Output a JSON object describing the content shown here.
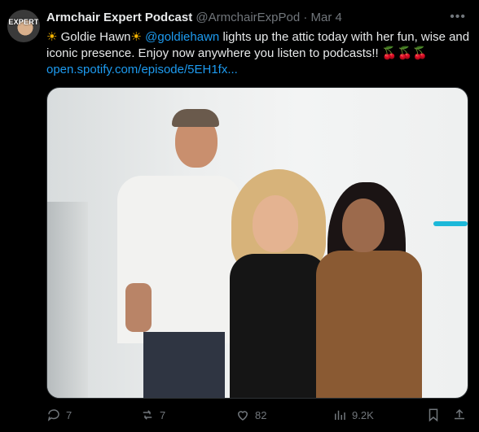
{
  "author": {
    "avatar_text": "EXPERT",
    "name": "Armchair Expert Podcast",
    "handle": "@ArmchairExpPod",
    "separator": "·",
    "date": "Mar 4"
  },
  "tweet": {
    "sun_emoji": "☀",
    "name_text": "Goldie Hawn",
    "mention": "@goldiehawn",
    "body": "lights up the attic today with her fun, wise and iconic presence. Enjoy now anywhere you listen to podcasts!!",
    "cherries": "🍒🍒🍒",
    "link": "open.spotify.com/episode/5EH1fx..."
  },
  "actions": {
    "replies": "7",
    "reposts": "7",
    "likes": "82",
    "views": "9.2K"
  },
  "icons": {
    "more": "more-options-icon",
    "reply": "reply-icon",
    "repost": "repost-icon",
    "like": "heart-icon",
    "views": "views-chart-icon",
    "bookmark": "bookmark-icon",
    "share": "share-icon"
  },
  "colors": {
    "background": "#000000",
    "text": "#e7e9ea",
    "muted": "#71767b",
    "accent": "#1d9bf0"
  }
}
